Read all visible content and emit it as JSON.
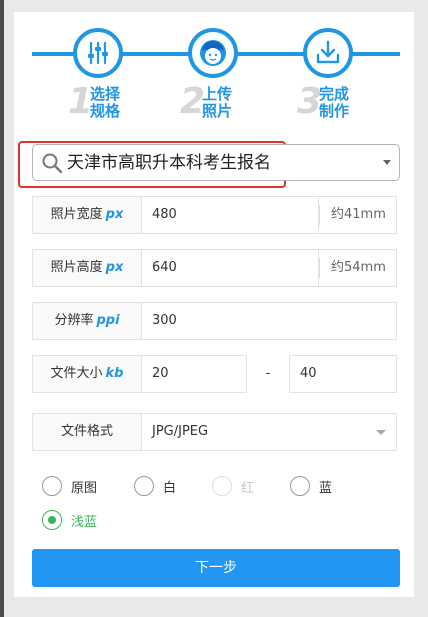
{
  "steps": [
    {
      "num": "1",
      "label": "选择规格",
      "icon": "sliders-icon"
    },
    {
      "num": "2",
      "label": "上传照片",
      "icon": "face-icon"
    },
    {
      "num": "3",
      "label": "完成制作",
      "icon": "download-icon"
    }
  ],
  "spec_select": {
    "value": "天津市高职升本科考生报名"
  },
  "fields": {
    "width": {
      "label": "照片宽度",
      "unit": "px",
      "value": "480",
      "hint": "约41mm"
    },
    "height": {
      "label": "照片高度",
      "unit": "px",
      "value": "640",
      "hint": "约54mm"
    },
    "resolution": {
      "label": "分辨率",
      "unit": "ppi",
      "value": "300"
    },
    "filesize": {
      "label": "文件大小",
      "unit": "kb",
      "min": "20",
      "separator": "-",
      "max": "40"
    },
    "format": {
      "label": "文件格式",
      "value": "JPG/JPEG"
    }
  },
  "background": {
    "options": [
      {
        "label": "原图",
        "state": "normal"
      },
      {
        "label": "白",
        "state": "normal"
      },
      {
        "label": "红",
        "state": "disabled"
      },
      {
        "label": "蓝",
        "state": "normal"
      },
      {
        "label": "浅蓝",
        "state": "checked"
      }
    ]
  },
  "next_button": "下一步",
  "colors": {
    "accent": "#2196f3",
    "highlight_border": "#d9342b",
    "checked": "#3bb75a"
  }
}
